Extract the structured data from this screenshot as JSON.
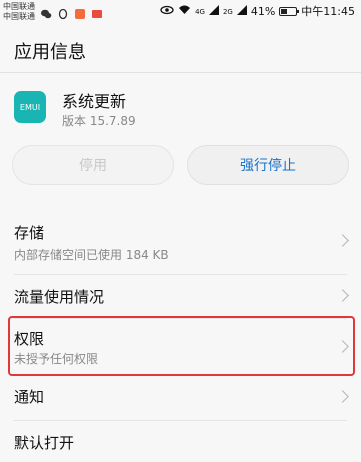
{
  "status_bar": {
    "carrier1": "中国联通",
    "carrier2": "中国联通",
    "network_labels": [
      "4G",
      "2G"
    ],
    "battery": "41%",
    "time": "中午11:45"
  },
  "header": {
    "title": "应用信息"
  },
  "app": {
    "icon_text": "EMUI",
    "name": "系统更新",
    "version": "版本 15.7.89"
  },
  "buttons": {
    "disable": "停用",
    "force_stop": "强行停止"
  },
  "settings": [
    {
      "label": "存储",
      "sub": "内部存储空间已使用 184 KB"
    },
    {
      "label": "流量使用情况",
      "sub": ""
    },
    {
      "label": "权限",
      "sub": "未授予任何权限"
    },
    {
      "label": "通知",
      "sub": ""
    },
    {
      "label": "默认打开",
      "sub": ""
    }
  ],
  "colors": {
    "accent": "#1a73c9",
    "highlight": "#e0383a",
    "app_icon_bg": "#19b5b3"
  }
}
